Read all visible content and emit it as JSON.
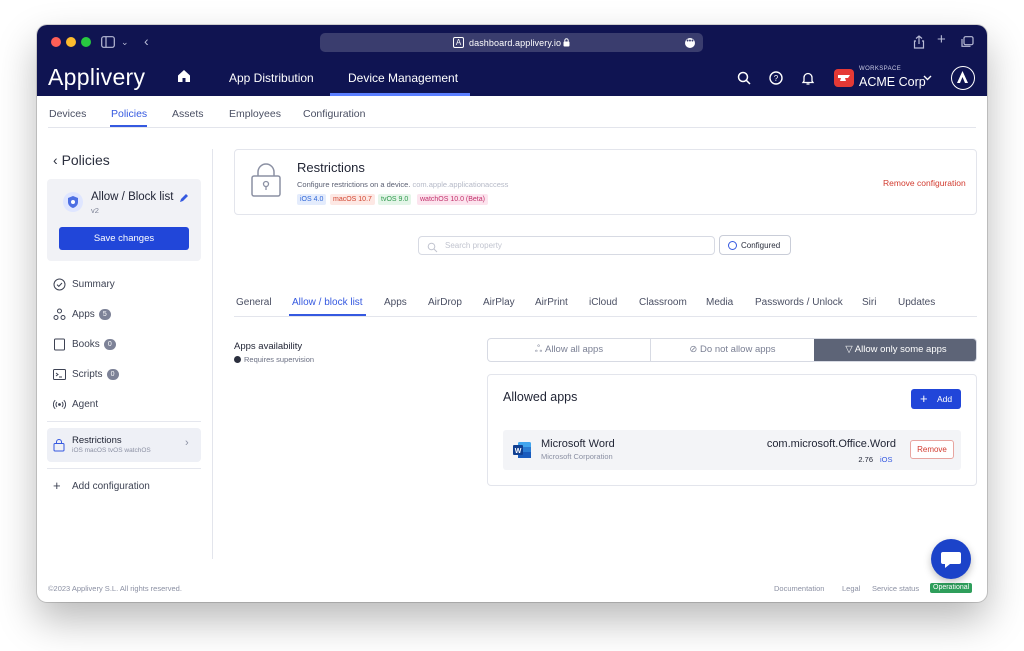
{
  "browser": {
    "url": "dashboard.applivery.io"
  },
  "header": {
    "logo": "Applivery",
    "nav": [
      "App Distribution",
      "Device Management"
    ],
    "workspace_label": "WORKSPACE",
    "workspace_name": "ACME Corp"
  },
  "subnav": [
    "Devices",
    "Policies",
    "Assets",
    "Employees",
    "Configuration"
  ],
  "sidebar": {
    "back_title": "Policies",
    "policy_name": "Allow / Block list",
    "policy_version": "v2",
    "save_label": "Save changes",
    "items": [
      {
        "label": "Summary",
        "icon": "check-circle-icon"
      },
      {
        "label": "Apps",
        "count": "5",
        "icon": "apps-icon"
      },
      {
        "label": "Books",
        "count": "0",
        "icon": "book-icon"
      },
      {
        "label": "Scripts",
        "count": "0",
        "icon": "terminal-icon"
      },
      {
        "label": "Agent",
        "icon": "broadcast-icon"
      }
    ],
    "restrictions": {
      "title": "Restrictions",
      "platforms": "iOS macOS tvOS watchOS"
    },
    "add_config": "Add configuration"
  },
  "config": {
    "title": "Restrictions",
    "description": "Configure restrictions on a device.",
    "identifier": "com.apple.applicationaccess",
    "remove_label": "Remove configuration",
    "pills": [
      {
        "text": "iOS 4.0",
        "color": "#2e66d8",
        "bg": "#e4ecfc"
      },
      {
        "text": "macOS 10.7",
        "color": "#d2452f",
        "bg": "#fde8e4"
      },
      {
        "text": "tvOS 9.0",
        "color": "#2f9a4d",
        "bg": "#e4f5e8"
      },
      {
        "text": "watchOS 10.0 (Beta)",
        "color": "#c2306b",
        "bg": "#fce4ee"
      }
    ]
  },
  "search": {
    "placeholder": "Search property",
    "configured_label": "Configured"
  },
  "tabs": [
    "General",
    "Allow / block list",
    "Apps",
    "AirDrop",
    "AirPlay",
    "AirPrint",
    "iCloud",
    "Classroom",
    "Media",
    "Passwords / Unlock",
    "Siri",
    "Updates"
  ],
  "availability": {
    "title": "Apps availability",
    "subtitle": "Requires supervision",
    "options": [
      "Allow all apps",
      "Do not allow apps",
      "Allow only some apps"
    ],
    "selected": "Allow only some apps"
  },
  "allowed_apps": {
    "title": "Allowed apps",
    "add_label": "Add",
    "remove_label": "Remove",
    "apps": [
      {
        "name": "Microsoft Word",
        "vendor": "Microsoft Corporation",
        "bundle_id": "com.microsoft.Office.Word",
        "version": "2.76",
        "os": "iOS"
      }
    ]
  },
  "footer": {
    "copyright": "©2023 Applivery S.L. All rights reserved.",
    "links": [
      "Documentation",
      "Legal",
      "Service status"
    ],
    "status": "Operational"
  },
  "colors": {
    "navy": "#0f1452",
    "accent": "#3559e0",
    "primary_button": "#2146d9",
    "danger": "#d23b2f",
    "success": "#2e9e5b"
  }
}
